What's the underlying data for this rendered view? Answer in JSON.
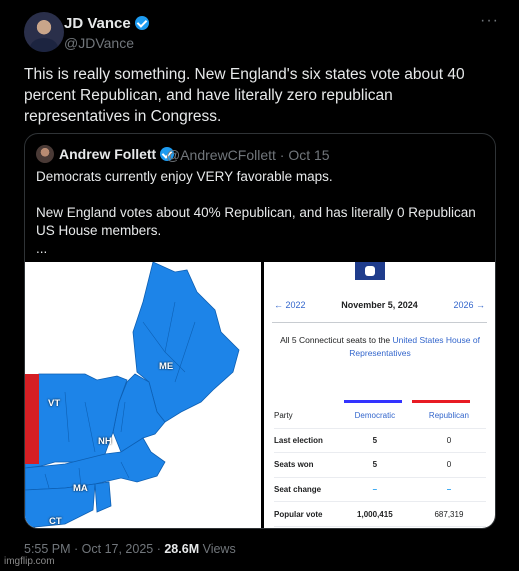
{
  "tweet": {
    "author_name": "JD Vance",
    "author_handle": "@JDVance",
    "text": "This is really something. New England's six states vote about 40 percent Republican, and have literally zero republican representatives in Congress.",
    "more_icon": "more-icon",
    "timestamp": "5:55 PM · Oct 17, 2025",
    "separator": " · ",
    "views_count": "28.6M",
    "views_label": "Views"
  },
  "quote": {
    "author_name": "Andrew Follett",
    "author_handle": "@AndrewCFollett · Oct 15",
    "paragraph1": "Democrats currently enjoy VERY favorable maps.",
    "paragraph2": "New England votes about 40% Republican, and has literally 0 Republican US House members.",
    "paragraph3": "..."
  },
  "map": {
    "labels": [
      "ME",
      "VT",
      "NH",
      "MA",
      "CT"
    ],
    "colors": {
      "democratic": "#1d84e8",
      "republican": "#d51f24",
      "land": "#1d84e8"
    }
  },
  "result_table": {
    "prev_link": "← 2022",
    "date": "November 5, 2024",
    "next_link": "2026 →",
    "blurb_prefix": "All 5 Connecticut seats to the ",
    "blurb_link": "United States House of Representatives",
    "header": {
      "party": "Party",
      "dem": "Democratic",
      "rep": "Republican"
    },
    "rows": [
      {
        "label": "Last election",
        "dem": "5",
        "rep": "0"
      },
      {
        "label": "Seats won",
        "dem": "5",
        "rep": "0"
      },
      {
        "label": "Seat change",
        "dem": "–",
        "rep": "–"
      },
      {
        "label": "Popular vote",
        "dem": "1,000,415",
        "rep": "687,319"
      }
    ],
    "colors": {
      "dem_bar": "#3333ff",
      "rep_bar": "#e81b23",
      "link": "#3366cc"
    }
  },
  "watermark": "imgflip.com"
}
